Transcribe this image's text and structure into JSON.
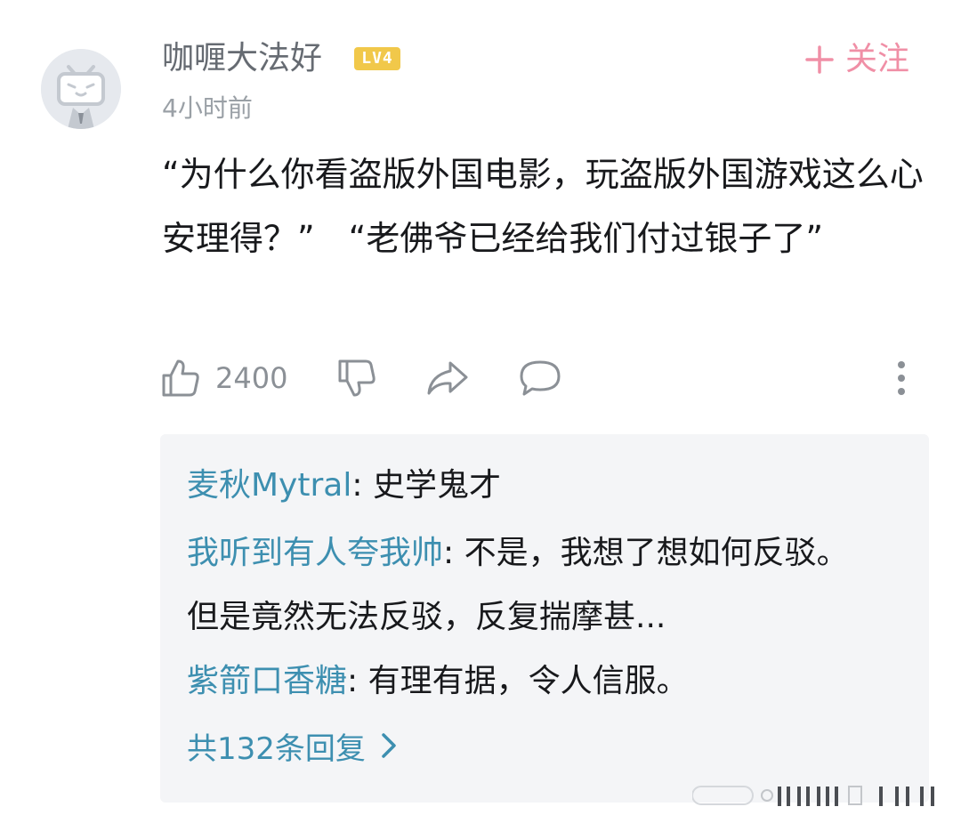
{
  "comment": {
    "username": "咖喱大法好",
    "level": "LV4",
    "time": "4小时前",
    "follow_label": "关注",
    "text": "“为什么你看盗版外国电影，玩盗版外国游戏这么心安理得？”　“老佛爷已经给我们付过银子了”",
    "like_count": "2400"
  },
  "replies": {
    "items": [
      {
        "user": "麦秋Mytral",
        "sep": ": ",
        "text": "史学鬼才"
      },
      {
        "user": "我听到有人夸我帅",
        "sep": ": ",
        "text": "不是，我想了想如何反驳。但是竟然无法反驳，反复揣摩甚..."
      },
      {
        "user": "紫箭口香糖",
        "sep": ": ",
        "text": "有理有据，令人信服。"
      }
    ],
    "view_all": "共132条回复"
  },
  "colors": {
    "accent_link": "#3d8fb0",
    "follow_pink": "#f08fa6",
    "level_badge": "#f1c84a",
    "meta_gray": "#9aa0a6",
    "reply_panel_bg": "#f4f5f7"
  },
  "icons": {
    "avatar": "bilibili-tv-default-avatar",
    "follow": "plus-icon",
    "like": "thumbs-up-icon",
    "dislike": "thumbs-down-icon",
    "share": "share-arrow-icon",
    "reply": "speech-bubble-icon",
    "more": "more-vertical-icon",
    "view_all": "chevron-right-icon"
  }
}
